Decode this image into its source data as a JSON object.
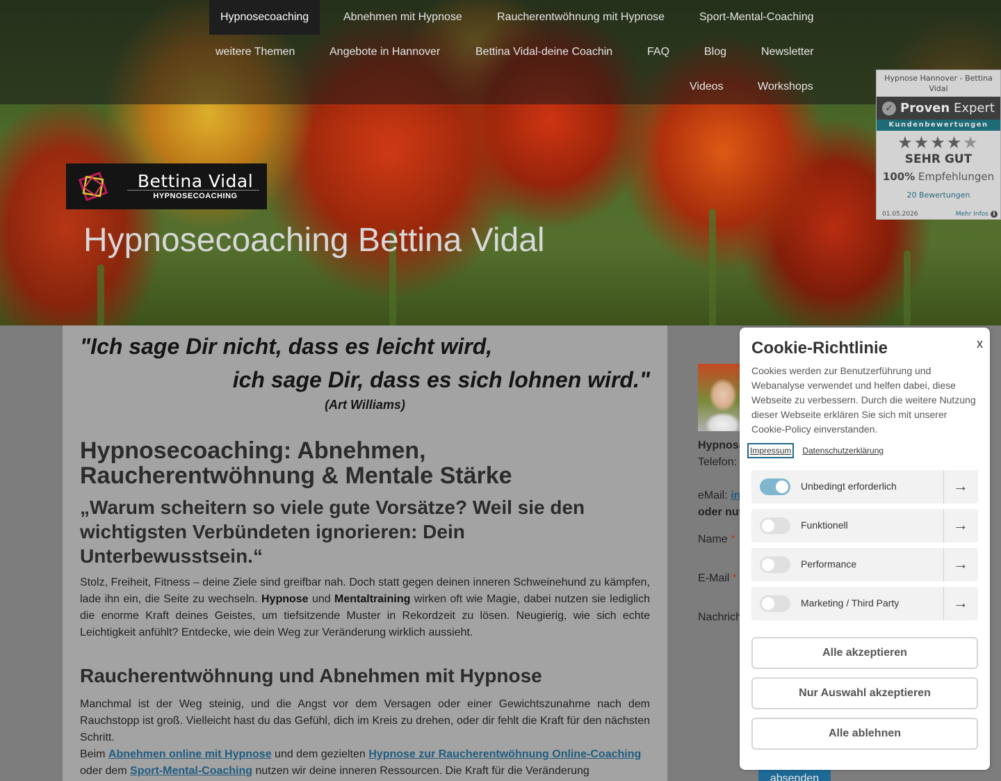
{
  "nav": {
    "row1": [
      "Hypnosecoaching",
      "Abnehmen mit Hypnose",
      "Raucherentwöhnung mit Hypnose",
      "Sport-Mental-Coaching"
    ],
    "row2": [
      "weitere Themen",
      "Angebote in Hannover",
      "Bettina Vidal-deine Coachin",
      "FAQ",
      "Blog",
      "Newsletter"
    ],
    "row3": [
      "Videos",
      "Workshops"
    ],
    "active": "Hypnosecoaching"
  },
  "logo": {
    "name": "Bettina Vidal",
    "subtitle": "HYPNOSECOACHING"
  },
  "hero": {
    "title": "Hypnosecoaching Bettina Vidal"
  },
  "proven_expert": {
    "heading": "Hypnose Hannover - Bettina Vidal",
    "brand_light": "Proven",
    "brand_rest": "Expert",
    "ribbon": "Kundenbewertungen",
    "stars": "★★★★",
    "half_star": "★",
    "rating_text": "SEHR GUT",
    "recommend_pct": "100%",
    "recommend_label": "Empfehlungen",
    "reviews": "20 Bewertungen",
    "date": "01.05.2026",
    "more": "Mehr Infos",
    "rating_value": 4.5,
    "rating_max": 5
  },
  "main": {
    "quote_line1": "\"Ich sage Dir nicht, dass es leicht wird,",
    "quote_line2": "ich sage Dir, dass es sich lohnen wird.\"",
    "quote_author": "(Art Williams)",
    "heading1": "Hypnosecoaching:  Abnehmen, Raucherentwöhnung & Mentale Stärke",
    "heading_quote": "„Warum scheitern so viele gute Vorsätze? Weil sie den wichtigsten Verbündeten ignorieren: Dein Unterbewusstsein.“",
    "p1_a": "Stolz, Freiheit, Fitness – deine Ziele sind greifbar nah. Doch statt gegen deinen inneren Schweinehund zu kämpfen, lade ihn ein, die Seite zu wechseln. ",
    "p1_b1": "Hypnose",
    "p1_c": " und ",
    "p1_b2": "Mentaltraining",
    "p1_d": " wirken oft wie Magie, dabei nutzen sie lediglich die enorme Kraft deines Geistes, um tiefsitzende Muster in Rekordzeit zu lösen. Neugierig, wie sich echte Leichtigkeit anfühlt? Entdecke, wie dein Weg zur Veränderung wirklich aussieht.",
    "heading2": "Raucherentwöhnung und Abnehmen mit Hypnose",
    "p2": "Manchmal ist der Weg steinig, und die Angst vor dem Versagen oder einer Gewichtszunahme nach dem Rauchstopp ist groß. Vielleicht hast du das Gefühl, dich im Kreis zu drehen, oder dir fehlt die Kraft für den nächsten Schritt.",
    "p3_a": "Beim ",
    "p3_link1": "Abnehmen online mit Hypnose",
    "p3_b": " und dem gezielten ",
    "p3_link2": "Hypnose zur Raucherentwöhnung Online-Coaching ",
    "p3_c": "oder dem ",
    "p3_link3": "Sport-Mental-Coaching",
    "p3_d": " nutzen wir deine inneren Ressourcen. Die Kraft für die Veränderung"
  },
  "sidebar": {
    "name_partial": "Hypnose",
    "phone_partial": "Telefon:",
    "email_label": "eMail:",
    "email_partial": "in",
    "or_partial": "oder nut",
    "field_name": "Name",
    "field_email": "E-Mail",
    "field_message_partial": "Nachrich",
    "required_mark": "*",
    "submit": "absenden"
  },
  "cookie": {
    "title": "Cookie-Richtlinie",
    "close": "x",
    "text": "Cookies werden zur Benutzerführung und Webanalyse verwendet und helfen dabei, diese Webseite zu verbessern. Durch die weitere Nutzung dieser Webseite erklären Sie sich mit unserer Cookie-Policy einverstanden.",
    "link_impressum": "Impressum",
    "link_privacy": "Datenschutzerklärung",
    "categories": [
      {
        "label": "Unbedingt erforderlich",
        "on": true
      },
      {
        "label": "Funktionell",
        "on": false
      },
      {
        "label": "Performance",
        "on": false
      },
      {
        "label": "Marketing / Third Party",
        "on": false
      }
    ],
    "arrow": "→",
    "btn_accept_all": "Alle akzeptieren",
    "btn_accept_selection": "Nur Auswahl akzeptieren",
    "btn_reject_all": "Alle ablehnen"
  }
}
